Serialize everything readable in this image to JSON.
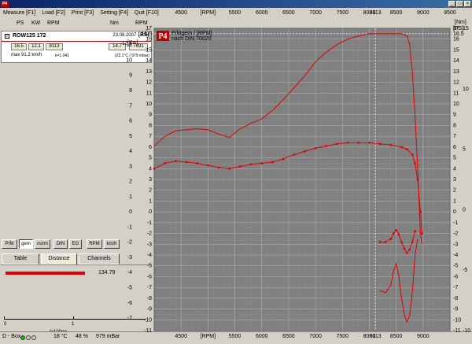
{
  "window": {
    "title": ""
  },
  "menu": [
    "Measure [F1]",
    "Load [F2]",
    "Print [F3]",
    "Setting [F4]",
    "Quit [F10]"
  ],
  "columns": {
    "ps": "PS",
    "kw": "KW",
    "rpm": "RPM",
    "nm": "Nm",
    "rpm2": "RPM"
  },
  "run": {
    "checked": "✓",
    "name": "ROW125 172",
    "date": "23.08.2007  15:14",
    "ps": "16.5",
    "kw": "12.1",
    "rpm": "8113",
    "nm": "14.7",
    "nm_rpm": "7691",
    "max_speed": "max 91.2 km/h",
    "k": "k=1.041",
    "env": "(22.1°C / 979 mbar)"
  },
  "toggles": [
    "P/M",
    "gem",
    "norm",
    "DIN",
    "EG",
    "RPM",
    "km/h"
  ],
  "pressed_toggles": [
    "gem"
  ],
  "tabs": [
    "Table",
    "Distance",
    "Channels"
  ],
  "active_tab": "Distance",
  "distance": {
    "value": "134.79",
    "axis_min": "0",
    "axis_mark": "1",
    "axis_unit": "(x100m)",
    "fraction": 0.56
  },
  "status": {
    "device": "D - Box",
    "temperature": "18 °C",
    "humidity": "48 %",
    "pressure": "979 mBar"
  },
  "colors": {
    "curve": "#e00000",
    "plot_bg": "#808080",
    "title_bar": "#0a246a"
  },
  "chart_data": {
    "type": "line",
    "logo": "P4",
    "legend_line1": "P/Mgem / [RPM]",
    "legend_line2": "nach DIN 70020",
    "xlabel": "[RPM]",
    "cursor_label": "8113",
    "xlim": [
      4000,
      9500
    ],
    "x_ticks": [
      "4500",
      "[RPM]",
      "5500",
      "6000",
      "6500",
      "7000",
      "7500",
      "8000",
      "8500",
      "9000",
      "9500"
    ],
    "bottom_ticks": [
      "4500",
      "[RPM]",
      "5500",
      "6000",
      "6500",
      "7000",
      "7500",
      "8000",
      "8500",
      "9000"
    ],
    "cursor_rpm": 8113,
    "y_left_outer": {
      "label": "[Kw]",
      "lim": [
        -11,
        12.1
      ],
      "extra_top": "12.1"
    },
    "y_left_inner": {
      "label": "[PS]",
      "lim": [
        -11,
        17
      ]
    },
    "y_right_ps": {
      "label": "[PS]",
      "ticks": [
        "17",
        "16.5",
        "16",
        "15",
        "14",
        "13",
        "12",
        "11",
        "10",
        "9",
        "8",
        "7",
        "6",
        "5",
        "4",
        "3",
        "2",
        "1",
        "0",
        "-1",
        "-2",
        "-3",
        "-4",
        "-5",
        "-6",
        "-7",
        "-8",
        "-9",
        "-10",
        "-11"
      ]
    },
    "y_right_nm": {
      "label": "[Nm]",
      "lim": [
        -10,
        15
      ],
      "ticks": [
        "15",
        "10",
        "5",
        "0",
        "-5",
        "-10"
      ]
    },
    "series": [
      {
        "name": "",
        "x": [
          4000,
          4200,
          4400,
          4600,
          4800,
          5000,
          5200,
          5400,
          5600,
          5800,
          6000,
          6200,
          6400,
          6600,
          6800,
          7000,
          7200,
          7400,
          7600,
          7800,
          8000,
          8113,
          8300,
          8500,
          8600,
          8650,
          8700,
          8750,
          8800,
          8850,
          8900,
          8950,
          8980
        ],
        "y": [
          6.1,
          7.0,
          7.5,
          7.6,
          7.7,
          7.6,
          7.2,
          6.9,
          7.7,
          8.2,
          8.6,
          9.4,
          10.4,
          11.5,
          12.6,
          13.9,
          14.8,
          15.5,
          16.0,
          16.3,
          16.5,
          16.5,
          16.5,
          16.5,
          16.5,
          16.4,
          16.3,
          15.5,
          13.0,
          9.0,
          4.0,
          -2.0,
          -3.0
        ]
      },
      {
        "name": "",
        "x": [
          4000,
          4200,
          4400,
          4600,
          4800,
          5000,
          5200,
          5400,
          5600,
          5800,
          6000,
          6200,
          6400,
          6600,
          6800,
          7000,
          7200,
          7400,
          7600,
          7800,
          8000,
          8200,
          8400,
          8600,
          8700,
          8800,
          8850,
          8900,
          8950,
          8980
        ],
        "y": [
          4.0,
          4.5,
          4.7,
          4.6,
          4.5,
          4.3,
          4.1,
          4.0,
          4.2,
          4.4,
          4.5,
          4.6,
          4.9,
          5.3,
          5.6,
          5.9,
          6.1,
          6.3,
          6.4,
          6.4,
          6.4,
          6.3,
          6.2,
          6.0,
          5.8,
          5.3,
          4.5,
          3.0,
          0.0,
          -2.0
        ]
      },
      {
        "name": "",
        "x": [
          8200,
          8300,
          8400,
          8450,
          8500,
          8550,
          8600,
          8650,
          8700,
          8750,
          8800,
          8850
        ],
        "y": [
          -2.8,
          -2.8,
          -2.5,
          -2.0,
          -1.7,
          -2.1,
          -2.8,
          -3.4,
          -3.8,
          -3.5,
          -2.8,
          -1.8
        ]
      },
      {
        "name": "",
        "x": [
          8200,
          8300,
          8400,
          8450,
          8500,
          8550,
          8600,
          8650,
          8700,
          8750,
          8800,
          8850,
          8900
        ],
        "y": [
          -7.3,
          -7.5,
          -6.8,
          -5.5,
          -4.8,
          -6.0,
          -8.0,
          -9.5,
          -10.2,
          -9.6,
          -7.5,
          -4.0,
          -2.5
        ]
      }
    ]
  }
}
